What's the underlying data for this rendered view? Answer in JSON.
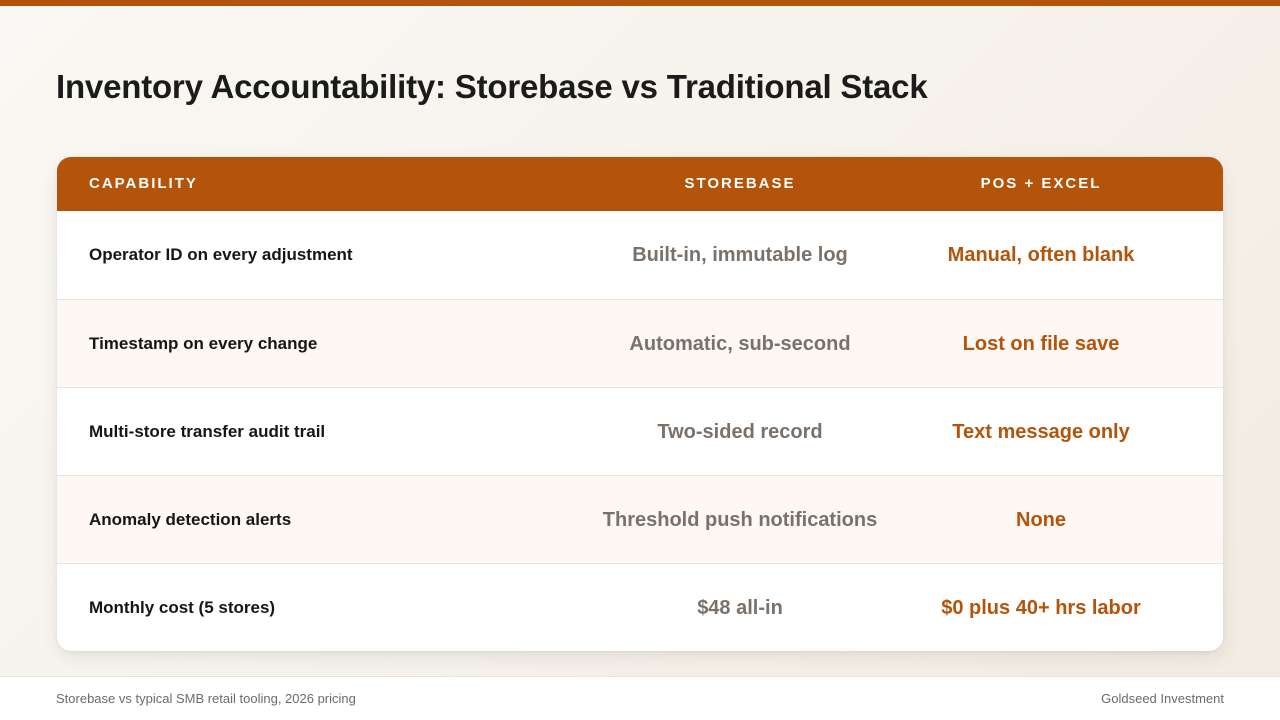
{
  "colors": {
    "accent": "#b4540b",
    "storebase_text": "#7a716b",
    "background": "#f6f2ec"
  },
  "title": "Inventory Accountability: Storebase vs Traditional Stack",
  "table": {
    "headers": {
      "capability": "Capability",
      "storebase": "Storebase",
      "pos_excel": "POS + Excel"
    },
    "rows": [
      {
        "capability": "Operator ID on every adjustment",
        "storebase": "Built-in, immutable log",
        "pos_excel": "Manual, often blank"
      },
      {
        "capability": "Timestamp on every change",
        "storebase": "Automatic, sub-second",
        "pos_excel": "Lost on file save"
      },
      {
        "capability": "Multi-store transfer audit trail",
        "storebase": "Two-sided record",
        "pos_excel": "Text message only"
      },
      {
        "capability": "Anomaly detection alerts",
        "storebase": "Threshold push notifications",
        "pos_excel": "None"
      },
      {
        "capability": "Monthly cost (5 stores)",
        "storebase": "$48 all-in",
        "pos_excel": "$0 plus 40+ hrs labor"
      }
    ]
  },
  "footer": {
    "source": "Storebase vs typical SMB retail tooling, 2026 pricing",
    "brand": "Goldseed Investment"
  }
}
